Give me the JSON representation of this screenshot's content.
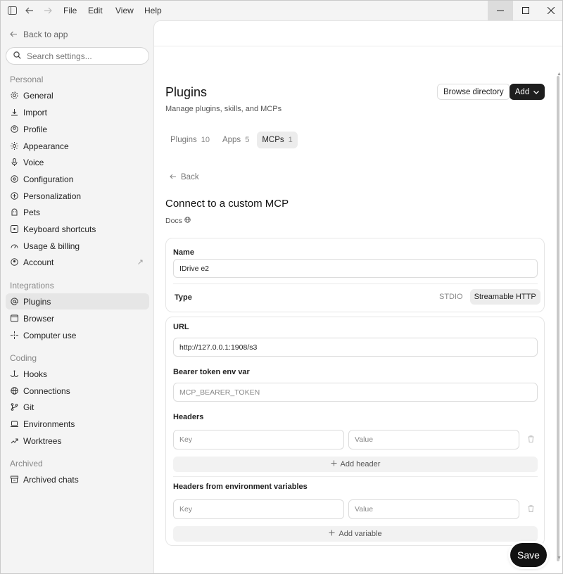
{
  "titlebar": {
    "menu": [
      "File",
      "Edit",
      "View",
      "Help"
    ],
    "icons": [
      "sidebar-toggle-icon",
      "back-arrow-icon",
      "forward-arrow-icon"
    ]
  },
  "sidebar": {
    "back_label": "Back to app",
    "search_placeholder": "Search settings...",
    "sections": [
      {
        "title": "Personal",
        "items": [
          {
            "label": "General",
            "icon": "gear-icon"
          },
          {
            "label": "Import",
            "icon": "download-icon"
          },
          {
            "label": "Profile",
            "icon": "user-circle-icon"
          },
          {
            "label": "Appearance",
            "icon": "sun-icon"
          },
          {
            "label": "Voice",
            "icon": "microphone-icon"
          },
          {
            "label": "Configuration",
            "icon": "settings-icon"
          },
          {
            "label": "Personalization",
            "icon": "sparkle-circle-icon"
          },
          {
            "label": "Pets",
            "icon": "pet-icon"
          },
          {
            "label": "Keyboard shortcuts",
            "icon": "keyboard-icon"
          },
          {
            "label": "Usage & billing",
            "icon": "gauge-icon"
          },
          {
            "label": "Account",
            "icon": "account-icon",
            "external": "↗"
          }
        ]
      },
      {
        "title": "Integrations",
        "items": [
          {
            "label": "Plugins",
            "icon": "at-icon",
            "active": true
          },
          {
            "label": "Browser",
            "icon": "browser-icon"
          },
          {
            "label": "Computer use",
            "icon": "cursor-sparkle-icon"
          }
        ]
      },
      {
        "title": "Coding",
        "items": [
          {
            "label": "Hooks",
            "icon": "hook-icon"
          },
          {
            "label": "Connections",
            "icon": "globe-icon"
          },
          {
            "label": "Git",
            "icon": "git-branch-icon"
          },
          {
            "label": "Environments",
            "icon": "laptop-icon"
          },
          {
            "label": "Worktrees",
            "icon": "worktree-icon"
          }
        ]
      },
      {
        "title": "Archived",
        "items": [
          {
            "label": "Archived chats",
            "icon": "archive-icon"
          }
        ]
      }
    ]
  },
  "main": {
    "title": "Plugins",
    "subtitle": "Manage plugins, skills, and MCPs",
    "browse_label": "Browse directory",
    "add_label": "Add",
    "tabs": [
      {
        "label": "Plugins",
        "count": "10"
      },
      {
        "label": "Apps",
        "count": "5"
      },
      {
        "label": "MCPs",
        "count": "1",
        "active": true
      }
    ],
    "back_label": "Back",
    "section_title": "Connect to a custom MCP",
    "docs_label": "Docs",
    "form": {
      "name_label": "Name",
      "name_value": "IDrive e2",
      "type_label": "Type",
      "type_options": [
        {
          "label": "STDIO",
          "active": false
        },
        {
          "label": "Streamable HTTP",
          "active": true
        }
      ],
      "url_label": "URL",
      "url_value": "http://127.0.0.1:1908/s3",
      "bearer_label": "Bearer token env var",
      "bearer_placeholder": "MCP_BEARER_TOKEN",
      "headers_label": "Headers",
      "key_placeholder": "Key",
      "value_placeholder": "Value",
      "add_header_label": "Add header",
      "env_headers_label": "Headers from environment variables",
      "add_variable_label": "Add variable"
    },
    "save_label": "Save"
  }
}
